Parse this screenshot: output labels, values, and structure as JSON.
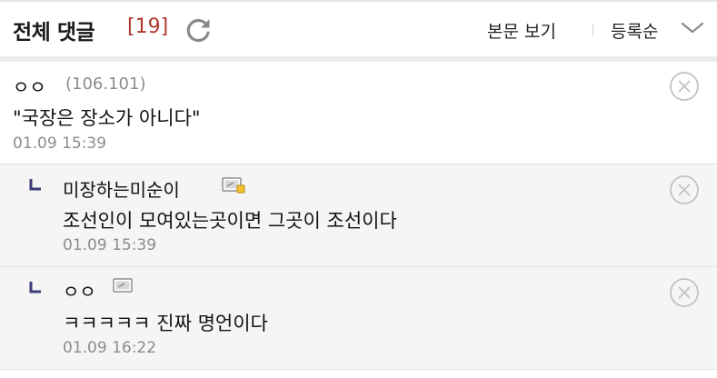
{
  "header": {
    "title": "전체 댓글",
    "count": "[19]",
    "refresh_icon": "refresh-icon",
    "view_post_label": "본문 보기",
    "sort_label": "등록순",
    "sort_icon": "chevron-down-icon"
  },
  "colors": {
    "count": "#b03a2e",
    "reply_bg": "#f5f5f5",
    "reply_arrow": "#3b3b7a",
    "meta_gray": "#8c8c8c"
  },
  "comments": [
    {
      "author": "ㅇㅇ",
      "ip": "(106.101)",
      "body": "\"국장은 장소가 아니다\"",
      "date": "01.09 15:39",
      "is_reply": false,
      "delete_icon": "close-circle-icon"
    },
    {
      "author": "미장하는미순이",
      "body": "조선인이 모여있는곳이면 그곳이 조선이다",
      "date": "01.09 15:39",
      "is_reply": true,
      "member_icon": "fixed-member-icon",
      "delete_icon": "close-circle-icon"
    },
    {
      "author": "ㅇㅇ",
      "body": "ㅋㅋㅋㅋㅋ 진짜 명언이다",
      "date": "01.09 16:22",
      "is_reply": true,
      "member_icon": "member-icon",
      "delete_icon": "close-circle-icon"
    }
  ]
}
